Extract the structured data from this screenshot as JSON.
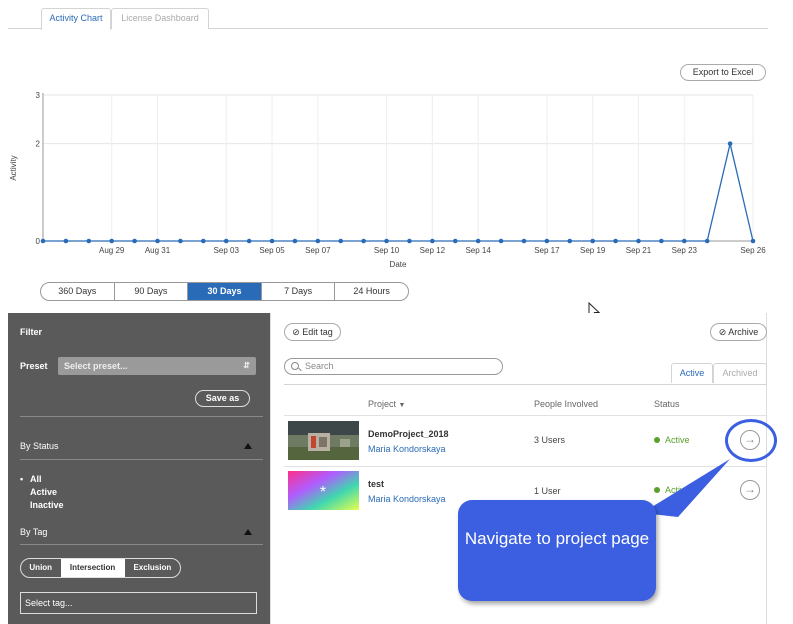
{
  "tabs": [
    {
      "label": "Activity Chart",
      "active": true
    },
    {
      "label": "License Dashboard",
      "active": false
    }
  ],
  "export_label": "Export to Excel",
  "chart_data": {
    "type": "line",
    "xlabel": "Date",
    "ylabel": "Activity",
    "ylim": [
      0,
      3
    ],
    "yticks": [
      "0",
      "2",
      "3"
    ],
    "xticks": [
      "Aug 29",
      "Aug 31",
      "Sep 03",
      "Sep 05",
      "Sep 07",
      "Sep 10",
      "Sep 12",
      "Sep 14",
      "Sep 17",
      "Sep 19",
      "Sep 21",
      "Sep 23",
      "Sep 26"
    ],
    "values": [
      0,
      0,
      0,
      0,
      0,
      0,
      0,
      0,
      0,
      0,
      0,
      0,
      0,
      0,
      0,
      0,
      0,
      0,
      0,
      0,
      0,
      0,
      0,
      0,
      0,
      0,
      0,
      0,
      0,
      0,
      2,
      0
    ],
    "color": "#2a6bb8",
    "grid": true
  },
  "ranges": [
    {
      "label": "360 Days",
      "selected": false
    },
    {
      "label": "90 Days",
      "selected": false
    },
    {
      "label": "30 Days",
      "selected": true
    },
    {
      "label": "7 Days",
      "selected": false
    },
    {
      "label": "24 Hours",
      "selected": false
    }
  ],
  "filter": {
    "title": "Filter",
    "preset_label": "Preset",
    "preset_placeholder": "Select preset...",
    "save_as": "Save as",
    "by_status": "By Status",
    "status_options": [
      "All",
      "Active",
      "Inactive"
    ],
    "status_selected": "All",
    "by_tag": "By Tag",
    "tag_modes": [
      "Union",
      "Intersection",
      "Exclusion"
    ],
    "tag_mode_selected": "Intersection",
    "select_tag": "Select tag..."
  },
  "projects": {
    "edit_tag": "Edit tag",
    "archive": "Archive",
    "search_placeholder": "Search",
    "view_tabs": [
      "Active",
      "Archived"
    ],
    "columns": {
      "project": "Project",
      "people": "People Involved",
      "status": "Status"
    },
    "rows": [
      {
        "name": "DemoProject_2018",
        "owner": "Maria Kondorskaya",
        "people": "3 Users",
        "status": "Active"
      },
      {
        "name": "test",
        "owner": "Maria Kondorskaya",
        "people": "1 User",
        "status": "Active"
      }
    ]
  },
  "callout": {
    "text": "Navigate to project page",
    "color": "#3b5fe0"
  }
}
